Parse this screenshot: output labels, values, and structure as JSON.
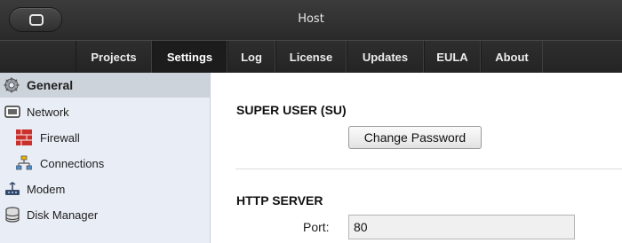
{
  "window": {
    "title": "Host"
  },
  "nav": {
    "tabs": [
      {
        "label": "Projects",
        "active": false
      },
      {
        "label": "Settings",
        "active": true
      },
      {
        "label": "Log",
        "active": false
      },
      {
        "label": "License",
        "active": false
      },
      {
        "label": "Updates",
        "active": false
      },
      {
        "label": "EULA",
        "active": false
      },
      {
        "label": "About",
        "active": false
      }
    ]
  },
  "sidebar": {
    "items": [
      {
        "label": "General",
        "icon": "gear-icon",
        "selected": true
      },
      {
        "label": "Network",
        "icon": "network-icon",
        "selected": false
      },
      {
        "label": "Firewall",
        "icon": "firewall-icon",
        "selected": false
      },
      {
        "label": "Connections",
        "icon": "connections-icon",
        "selected": false
      },
      {
        "label": "Modem",
        "icon": "modem-icon",
        "selected": false
      },
      {
        "label": "Disk Manager",
        "icon": "disk-icon",
        "selected": false
      }
    ]
  },
  "main": {
    "super_user": {
      "title": "SUPER USER (SU)",
      "change_password_label": "Change Password"
    },
    "http_server": {
      "title": "HTTP SERVER",
      "port_label": "Port:",
      "port_value": "80"
    }
  }
}
